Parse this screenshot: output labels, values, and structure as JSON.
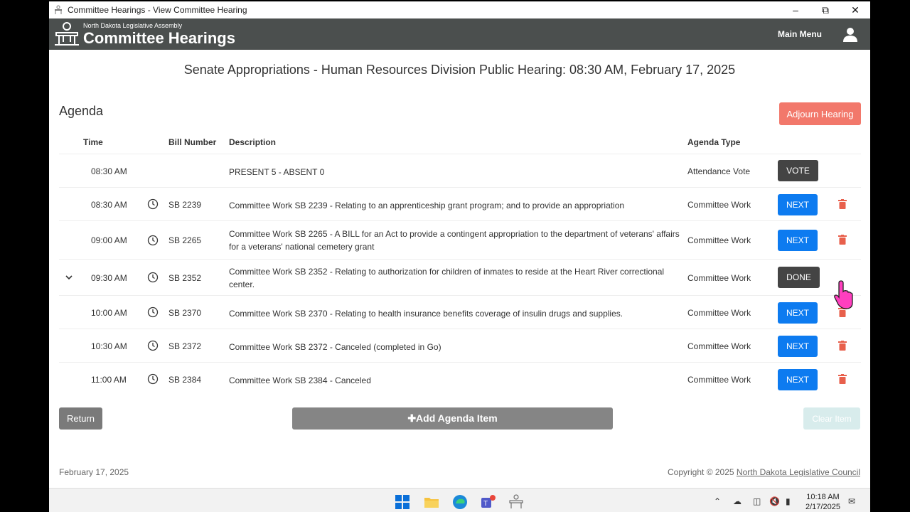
{
  "window": {
    "title": "Committee Hearings - View Committee Hearing",
    "controls": [
      "minimize-icon",
      "restore-icon",
      "close-icon"
    ]
  },
  "header": {
    "subtitle": "North Dakota Legislative Assembly",
    "title": "Committee Hearings",
    "main_menu": "Main Menu"
  },
  "hearing_title": "Senate Appropriations - Human Resources Division Public Hearing: 08:30 AM, February 17, 2025",
  "agenda": {
    "label": "Agenda",
    "adjourn_label": "Adjourn Hearing",
    "columns": {
      "time": "Time",
      "bill": "Bill Number",
      "description": "Description",
      "type": "Agenda Type"
    },
    "rows": [
      {
        "time": "08:30 AM",
        "bill": "",
        "description": "PRESENT 5 - ABSENT 0",
        "type": "Attendance Vote",
        "action": "VOTE"
      },
      {
        "time": "08:30 AM",
        "bill": "SB 2239",
        "description": "Committee Work SB 2239 - Relating to an apprenticeship grant program; and to provide an appropriation",
        "type": "Committee Work",
        "action": "NEXT"
      },
      {
        "time": "09:00 AM",
        "bill": "SB 2265",
        "description": "Committee Work SB 2265 - A BILL for an Act to provide a contingent appropriation to the department of veterans' affairs for a veterans' national cemetery grant",
        "type": "Committee Work",
        "action": "NEXT"
      },
      {
        "time": "09:30 AM",
        "bill": "SB 2352",
        "description": "Committee Work SB 2352 - Relating to authorization for children of inmates to reside at the Heart River correctional center.",
        "type": "Committee Work",
        "action": "DONE"
      },
      {
        "time": "10:00 AM",
        "bill": "SB 2370",
        "description": "Committee Work SB 2370 - Relating to health insurance benefits coverage of insulin drugs and supplies.",
        "type": "Committee Work",
        "action": "NEXT"
      },
      {
        "time": "10:30 AM",
        "bill": "SB 2372",
        "description": "Committee Work SB 2372 - Canceled (completed in Go)",
        "type": "Committee Work",
        "action": "NEXT"
      },
      {
        "time": "11:00 AM",
        "bill": "SB 2384",
        "description": "Committee Work SB 2384 - Canceled",
        "type": "Committee Work",
        "action": "NEXT"
      }
    ],
    "return_label": "Return",
    "add_label": "✚Add Agenda Item",
    "clear_label": "Clear Item"
  },
  "footer": {
    "date": "February 17, 2025",
    "copyright": "Copyright © 2025 ",
    "council_link": "North Dakota Legislative Council"
  },
  "taskbar": {
    "time": "10:18 AM",
    "date": "2/17/2025",
    "apps": [
      "windows-start-icon",
      "file-explorer-icon",
      "edge-browser-icon",
      "teams-icon",
      "committee-hearings-app-icon"
    ]
  },
  "colors": {
    "header_bg": "#4b4f4e",
    "adjourn": "#f2786b",
    "next": "#0d7bf0",
    "dark_button": "#444444",
    "trash": "#e8604c"
  }
}
